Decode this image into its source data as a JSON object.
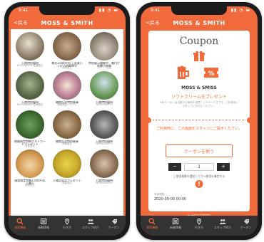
{
  "left_screen": {
    "status_time": "9:41",
    "status_icons": "▮▮ ◔ ▬",
    "back_label": "<戻る",
    "title": "MOSS & SMITH",
    "tiles": [
      {
        "title": "入館特別優待",
        "subtitle": "MOSS&SMITH店舗限定"
      },
      {
        "title": "株式2,000円以上お買い上げで特典進呈",
        "subtitle": "期間限定"
      },
      {
        "title": "特別展示開催中、着付け体験で特典",
        "subtitle": "スタッフ限定"
      },
      {
        "title": "入館特別優待",
        "subtitle": "MOSS&SMITH店舗限定"
      },
      {
        "title": "開館記念特別催事",
        "subtitle": "期間限定イベント"
      },
      {
        "title": "入館特別優待",
        "subtitle": "MOSS&SMITH"
      },
      {
        "title": "期間限定特典ポストカードプレゼント",
        "subtitle": "数量限定"
      },
      {
        "title": "開館記念特別催事",
        "subtitle": "期間限定"
      },
      {
        "title": "入館特別優待",
        "subtitle": "MOSS&SMITH"
      },
      {
        "title": "施設限定特典2,000円以上購入",
        "subtitle": "期間限定"
      },
      {
        "title": "入場記念品プレゼント",
        "subtitle": "数量限定"
      },
      {
        "title": "入館特別優待",
        "subtitle": "MOSS&SMITH"
      }
    ]
  },
  "tabs": [
    {
      "label": "探索機能",
      "icon": "search-icon"
    },
    {
      "label": "新着情報",
      "icon": "news-icon"
    },
    {
      "label": "行き方",
      "icon": "pin-icon"
    },
    {
      "label": "スタッフ紹介",
      "icon": "people-icon"
    },
    {
      "label": "クーポン",
      "icon": "coupon-icon"
    }
  ],
  "right_screen": {
    "status_time": "9:41",
    "status_icons": "▮▮ ◔ ▬",
    "back_label": "<戻る",
    "title": "MOSS & SMITH",
    "coupon_title": "Coupon",
    "brand": "MOSS & SMISS",
    "offer": "ソフトクリームをプレゼント",
    "description": "※本クーポンは当館での使用を前提としたサービスです。ご利用前にスタッフにお伝えください。",
    "notice": "ご利用時に、この画面をスタッフにご提示ください。",
    "use_button": "クーポンを使う",
    "quantity": "1",
    "minus": "−",
    "plus": "+",
    "confirm_text": "ご使用枚数を選択してから使用を確定する",
    "alert_icon": "!",
    "expiry_label": "有効期限",
    "expiry_date": "2020-00-00 00:00",
    "footer": "© MOSS&SMITH"
  },
  "colors": {
    "accent": "#f06a3b",
    "tabbar": "#333333"
  }
}
